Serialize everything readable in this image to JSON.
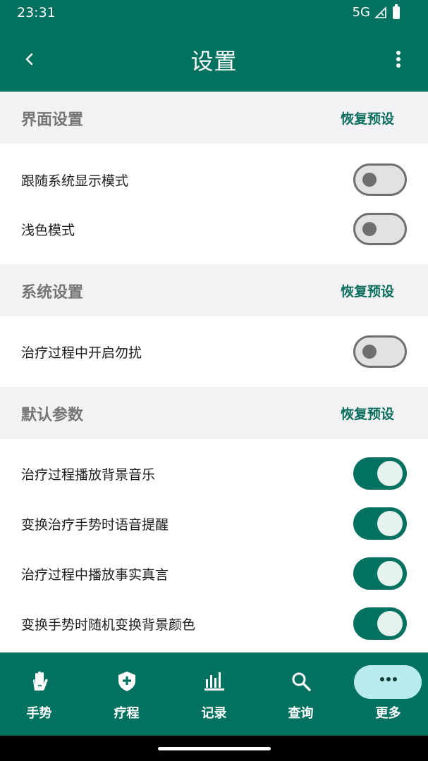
{
  "status": {
    "time": "23:31",
    "network": "5G"
  },
  "appbar": {
    "title": "设置"
  },
  "sections": [
    {
      "title": "界面设置",
      "reset": "恢复预设"
    },
    {
      "title": "系统设置",
      "reset": "恢复预设"
    },
    {
      "title": "默认参数",
      "reset": "恢复预设"
    }
  ],
  "settings": [
    {
      "label": "跟随系统显示模式",
      "enabled": false
    },
    {
      "label": "浅色模式",
      "enabled": false
    },
    {
      "label": "治疗过程中开启勿扰",
      "enabled": false
    },
    {
      "label": "治疗过程播放背景音乐",
      "enabled": true
    },
    {
      "label": "变换治疗手势时语音提醒",
      "enabled": true
    },
    {
      "label": "治疗过程中播放事实真言",
      "enabled": true
    },
    {
      "label": "变换手势时随机变换背景颜色",
      "enabled": true
    }
  ],
  "nav": [
    {
      "label": "手势",
      "icon": "hand-icon"
    },
    {
      "label": "疗程",
      "icon": "shield-plus-icon"
    },
    {
      "label": "记录",
      "icon": "bar-chart-icon"
    },
    {
      "label": "查询",
      "icon": "search-icon"
    },
    {
      "label": "更多",
      "icon": "more-horizontal-icon",
      "selected": true
    }
  ],
  "colors": {
    "primary": "#03715f",
    "section_bg": "#f2f1f3",
    "accent_text": "#0b6d5d",
    "selected_pill": "#b9ecec"
  }
}
